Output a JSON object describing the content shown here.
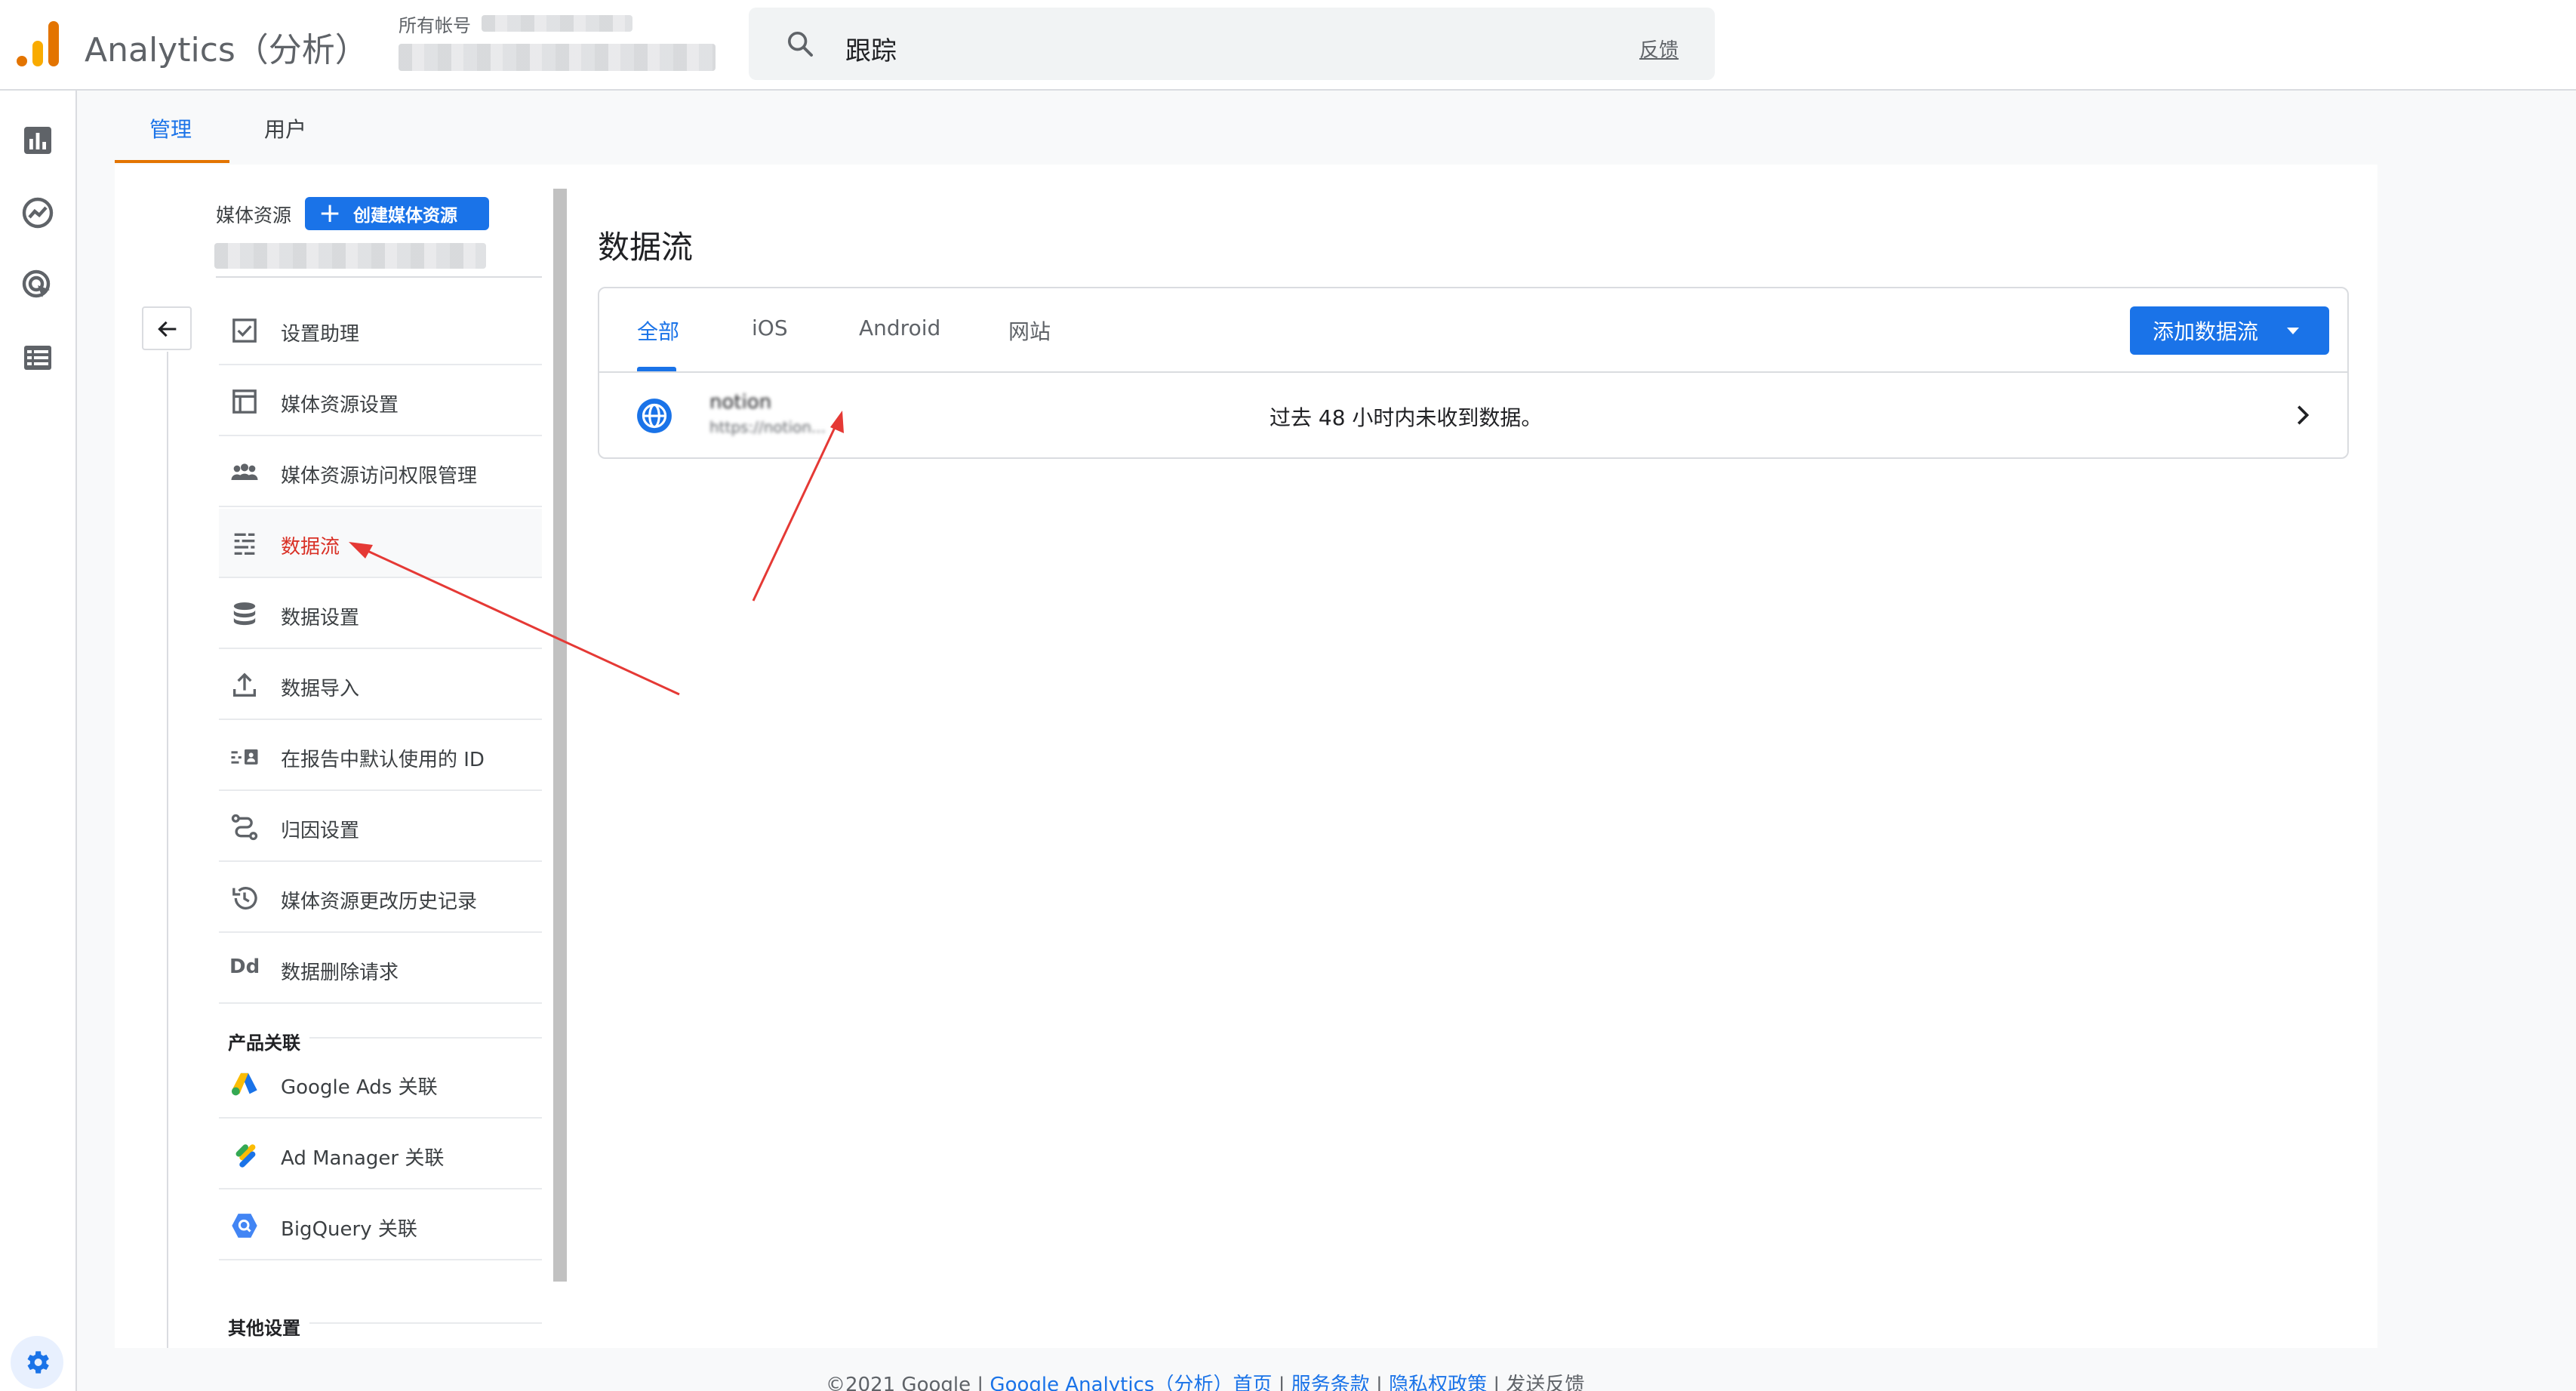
{
  "app": {
    "title": "Analytics（分析）",
    "account_label": "所有帐号"
  },
  "search": {
    "query": "跟踪",
    "feedback": "反馈"
  },
  "rail": {
    "icons": [
      "bar-chart-icon",
      "explore-icon",
      "target-icon",
      "list-icon"
    ],
    "settings_icon": "gear-icon"
  },
  "admin_tabs": [
    {
      "label": "管理",
      "active": true
    },
    {
      "label": "用户",
      "active": false
    }
  ],
  "property": {
    "label": "媒体资源",
    "create_button": "创建媒体资源"
  },
  "menu": {
    "items": [
      {
        "label": "设置助理",
        "icon": "checkbox-icon"
      },
      {
        "label": "媒体资源设置",
        "icon": "layout-icon"
      },
      {
        "label": "媒体资源访问权限管理",
        "icon": "people-icon"
      },
      {
        "label": "数据流",
        "icon": "streams-icon",
        "active": true
      },
      {
        "label": "数据设置",
        "icon": "database-icon"
      },
      {
        "label": "数据导入",
        "icon": "upload-icon"
      },
      {
        "label": "在报告中默认使用的 ID",
        "icon": "id-icon"
      },
      {
        "label": "归因设置",
        "icon": "attribution-icon"
      },
      {
        "label": "媒体资源更改历史记录",
        "icon": "history-icon"
      },
      {
        "label": "数据删除请求",
        "icon": "dd-icon"
      }
    ],
    "product_links_heading": "产品关联",
    "product_links": [
      {
        "label": "Google Ads 关联",
        "icon": "google-ads-icon"
      },
      {
        "label": "Ad Manager 关联",
        "icon": "ad-manager-icon"
      },
      {
        "label": "BigQuery 关联",
        "icon": "bigquery-icon"
      }
    ],
    "other_heading": "其他设置",
    "dd_glyph": "Dd"
  },
  "streams": {
    "title": "数据流",
    "tabs": [
      {
        "label": "全部",
        "active": true
      },
      {
        "label": "iOS",
        "active": false
      },
      {
        "label": "Android",
        "active": false
      },
      {
        "label": "网站",
        "active": false
      }
    ],
    "add_button": "添加数据流",
    "rows": [
      {
        "name": "notion",
        "url": "https://notion...",
        "status": "过去 48 小时内未收到数据。"
      }
    ]
  },
  "footer": {
    "copyright": "©2021 Google",
    "links": [
      "Google Analytics（分析）首页",
      "服务条款",
      "隐私权政策"
    ],
    "feedback": "发送反馈"
  },
  "colors": {
    "brand_blue": "#1a73e8",
    "active_red": "#d93025",
    "tab_orange": "#e37400",
    "annotation_red": "#e53935"
  }
}
